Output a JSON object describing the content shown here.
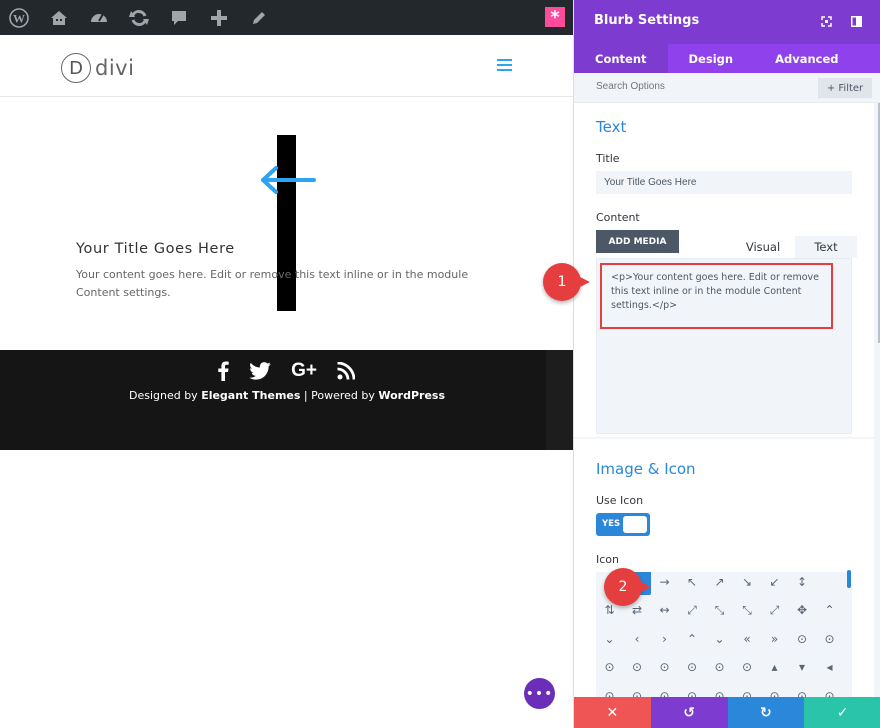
{
  "adminbar": {
    "icons": [
      "wordpress-icon",
      "home-icon",
      "dashboard-icon",
      "refresh-icon",
      "comment-icon",
      "plus-icon",
      "edit-icon"
    ],
    "pink_label": "*"
  },
  "site": {
    "logo_letter": "D",
    "logo_text": "divi"
  },
  "blurb": {
    "title": "Your Title Goes Here",
    "content": "Your content goes here. Edit or remove this text inline or in the module Content settings."
  },
  "footer": {
    "socials": [
      "f",
      "t",
      "G+",
      "rss"
    ],
    "credit_prefix": "Designed by ",
    "credit_brand": "Elegant Themes",
    "credit_mid": " | Powered by ",
    "credit_wp": "WordPress"
  },
  "fab_label": "•••",
  "panel": {
    "title": "Blurb Settings",
    "tabs": [
      {
        "label": "Content"
      },
      {
        "label": "Design"
      },
      {
        "label": "Advanced"
      }
    ],
    "search_placeholder": "Search Options",
    "filter_label": "+ Filter",
    "text_section": {
      "title": "Text",
      "title_label": "Title",
      "title_value": "Your Title Goes Here",
      "content_label": "Content",
      "add_media": "ADD MEDIA",
      "visual_tab": "Visual",
      "text_tab": "Text",
      "code": "<p>Your content goes here. Edit or remove this text inline or in the module Content settings.</p>"
    },
    "image_section": {
      "title": "Image & Icon",
      "use_icon_label": "Use Icon",
      "toggle": "YES",
      "icon_label": "Icon"
    },
    "icon_rows": [
      [
        "",
        "←",
        "→",
        "↖",
        "↗",
        "↘",
        "↙",
        "↕"
      ],
      [
        "⇅",
        "⇄",
        "↔",
        "⤢",
        "⤡",
        "⤡",
        "⤢",
        "✥",
        "⌃"
      ],
      [
        "⌄",
        "‹",
        "›",
        "⌃",
        "⌄",
        "«",
        "»",
        "⊙",
        "⊙"
      ],
      [
        "⊙",
        "⊙",
        "⊙",
        "⊙",
        "⊙",
        "⊙",
        "▴",
        "▾",
        "◂"
      ],
      [
        "⊙",
        "⊙",
        "⊙",
        "⊙",
        "⊙",
        "⊙",
        "⊙",
        "⊙",
        "⊙"
      ]
    ],
    "callout_1": "1",
    "callout_2": "2",
    "footer_buttons": [
      "✕",
      "↺",
      "↻",
      "✓"
    ],
    "footer_colors": [
      "#ef5555",
      "#7e3bd0",
      "#2b87da",
      "#29c4a9"
    ]
  }
}
